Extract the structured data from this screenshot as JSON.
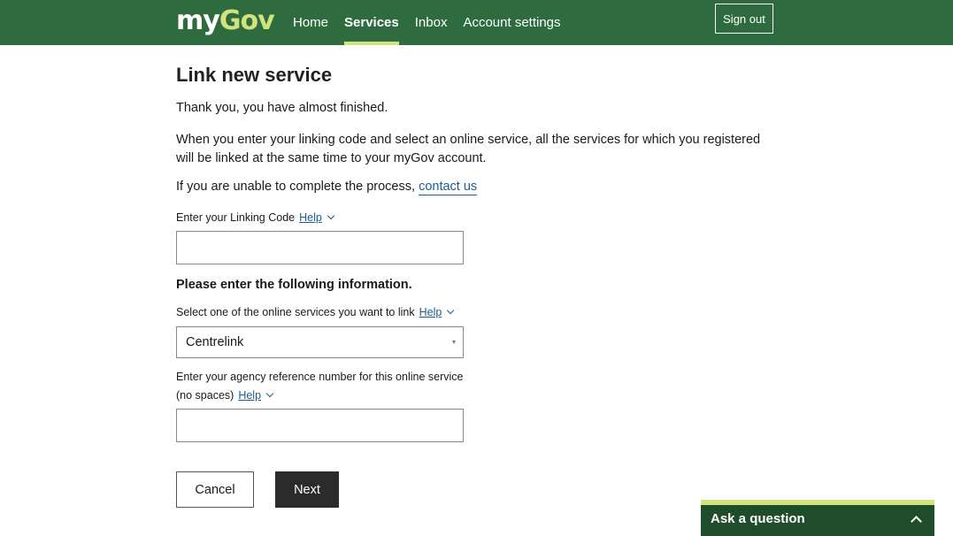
{
  "header": {
    "logo_my": "my",
    "logo_gov": "Gov",
    "nav": [
      {
        "label": "Home",
        "active": false
      },
      {
        "label": "Services",
        "active": true
      },
      {
        "label": "Inbox",
        "active": false
      },
      {
        "label": "Account settings",
        "active": false
      }
    ],
    "sign_out": "Sign out",
    "colors": {
      "background": "#2e6b3e",
      "accent": "#d2e37d"
    }
  },
  "main": {
    "title": "Link new service",
    "intro": "Thank you, you have almost finished.",
    "description": "When you enter your linking code and select an online service, all the services for which you registered will be linked at the same time to your myGov account.",
    "contact_prefix": "If you are unable to complete the process,",
    "contact_link": "contact us",
    "linking_code": {
      "label": "Enter your Linking Code",
      "help": "Help",
      "value": ""
    },
    "section_heading": "Please enter the following information.",
    "service_select": {
      "label": "Select one of the online services you want to link",
      "help": "Help",
      "selected": "Centrelink"
    },
    "reference": {
      "label_line1": "Enter your agency reference number for this online service",
      "label_line2": "(no spaces)",
      "help": "Help",
      "value": ""
    },
    "buttons": {
      "cancel": "Cancel",
      "next": "Next"
    }
  },
  "ask_widget": {
    "label": "Ask a question",
    "icon": "chevron-up-icon"
  }
}
